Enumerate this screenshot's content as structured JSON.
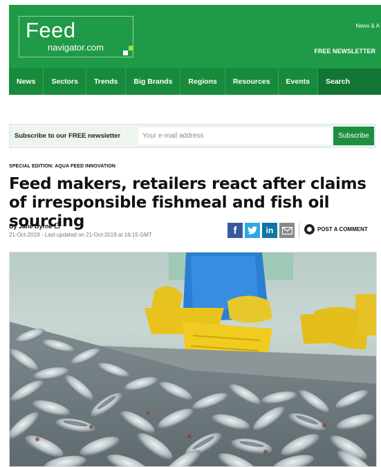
{
  "site": {
    "logo_main": "Feed",
    "logo_sub": "navigator.com",
    "top_link": "News & A",
    "newsletter_link": "FREE NEWSLETTER"
  },
  "nav": {
    "items": [
      "News",
      "Sectors",
      "Trends",
      "Big Brands",
      "Regions",
      "Resources",
      "Events",
      "Search"
    ]
  },
  "newsletter": {
    "label": "Subscribe to our FREE newsletter",
    "placeholder": "Your e-mail address",
    "button": "Subscribe"
  },
  "article": {
    "kicker": "SPECIAL EDITION: AQUA FEED INNOVATION",
    "headline": "Feed makers, retailers react after claims of irresponsible fishmeal and fish oil sourcing",
    "byline": "By Jane Byrne",
    "dateline": "21-Oct-2019 - Last updated on 21-Oct-2019 at 16:15 GMT",
    "comment_label": "POST A COMMENT"
  },
  "share": {
    "facebook": "f",
    "twitter": "t",
    "linkedin": "in"
  },
  "colors": {
    "brand_green": "#1f9a46",
    "nav_green": "#188a3c",
    "facebook": "#3a589e",
    "twitter": "#2fa8e0",
    "linkedin": "#0e76a8"
  }
}
